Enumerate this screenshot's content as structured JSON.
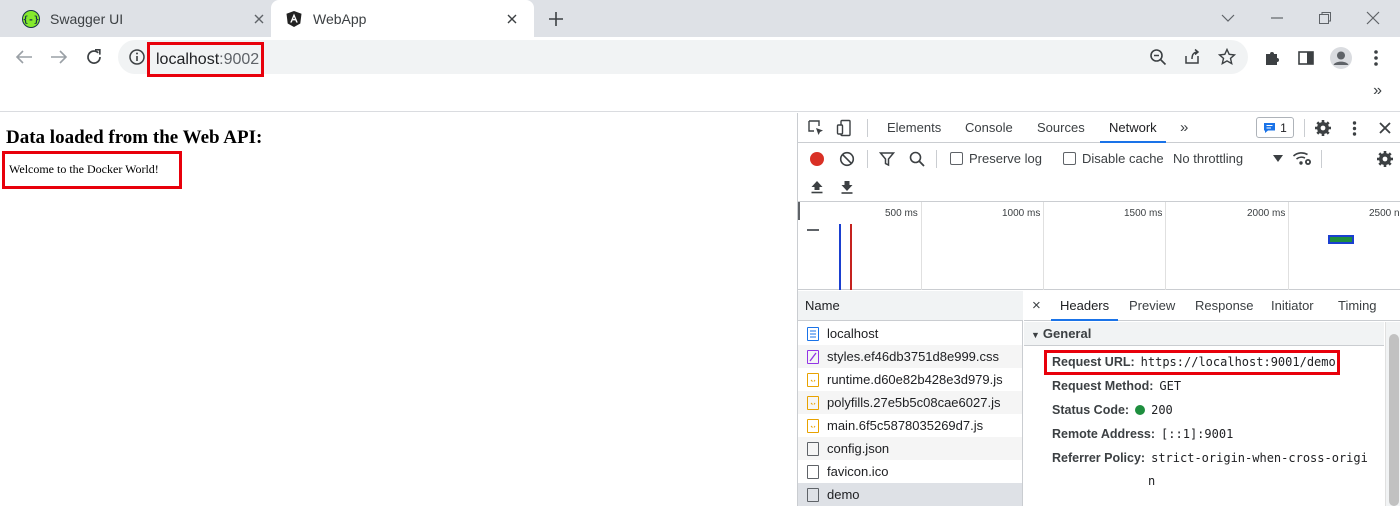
{
  "browser": {
    "tabs": [
      {
        "title": "Swagger UI",
        "active": false
      },
      {
        "title": "WebApp",
        "active": true
      }
    ],
    "url": {
      "host": "localhost",
      "port": ":9002"
    },
    "bookmarks_more": "»"
  },
  "page": {
    "heading": "Data loaded from the Web API:",
    "message": "Welcome to the Docker World!"
  },
  "devtools": {
    "tabs": [
      "Elements",
      "Console",
      "Sources",
      "Network"
    ],
    "active_tab": "Network",
    "more_tabs": "»",
    "issues_count": "1",
    "preserve_log": "Preserve log",
    "disable_cache": "Disable cache",
    "throttling": "No throttling",
    "overview_ticks": [
      "500 ms",
      "1000 ms",
      "1500 ms",
      "2000 ms",
      "2500 n"
    ],
    "name_header": "Name",
    "requests": [
      {
        "name": "localhost",
        "type": "doc"
      },
      {
        "name": "styles.ef46db3751d8e999.css",
        "type": "css"
      },
      {
        "name": "runtime.d60e82b428e3d979.js",
        "type": "js"
      },
      {
        "name": "polyfills.27e5b5c08cae6027.js",
        "type": "js"
      },
      {
        "name": "main.6f5c5878035269d7.js",
        "type": "js"
      },
      {
        "name": "config.json",
        "type": "other"
      },
      {
        "name": "favicon.ico",
        "type": "other"
      },
      {
        "name": "demo",
        "type": "other"
      }
    ],
    "detail_close": "×",
    "detail_tabs": [
      "Headers",
      "Preview",
      "Response",
      "Initiator",
      "Timing"
    ],
    "general_label": "General",
    "general": {
      "request_url_key": "Request URL:",
      "request_url": "https://localhost:9001/demo",
      "method_key": "Request Method:",
      "method": "GET",
      "status_key": "Status Code:",
      "status": "200",
      "remote_key": "Remote Address:",
      "remote": "[::1]:9001",
      "referrer_key": "Referrer Policy:",
      "referrer_line1": "strict-origin-when-cross-origi",
      "referrer_line2": "n"
    }
  },
  "colors": {
    "highlight": "#e8000b",
    "accent": "#1a73e8",
    "status_ok": "#1e8e3e"
  }
}
